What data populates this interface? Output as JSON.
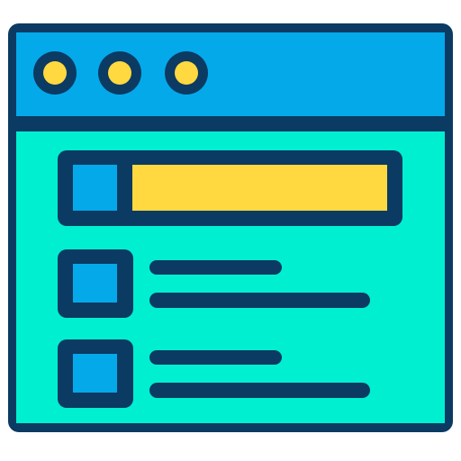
{
  "icon": {
    "name": "browser-window-list-icon",
    "colors": {
      "outline": "#0b3a63",
      "titlebar": "#04a9ea",
      "body": "#00efd1",
      "dots": "#ffd93f",
      "accent_blue": "#04a9ea",
      "accent_yellow": "#ffd93f"
    }
  },
  "window": {
    "buttons": [
      {
        "icon": "window-control-dot-icon"
      },
      {
        "icon": "window-control-dot-icon"
      },
      {
        "icon": "window-control-dot-icon"
      }
    ]
  },
  "content": {
    "search_bar": {
      "icon": "search-bar-icon"
    },
    "list": [
      {
        "icon": "checkbox-icon",
        "lines": 2
      },
      {
        "icon": "checkbox-icon",
        "lines": 2
      }
    ]
  }
}
